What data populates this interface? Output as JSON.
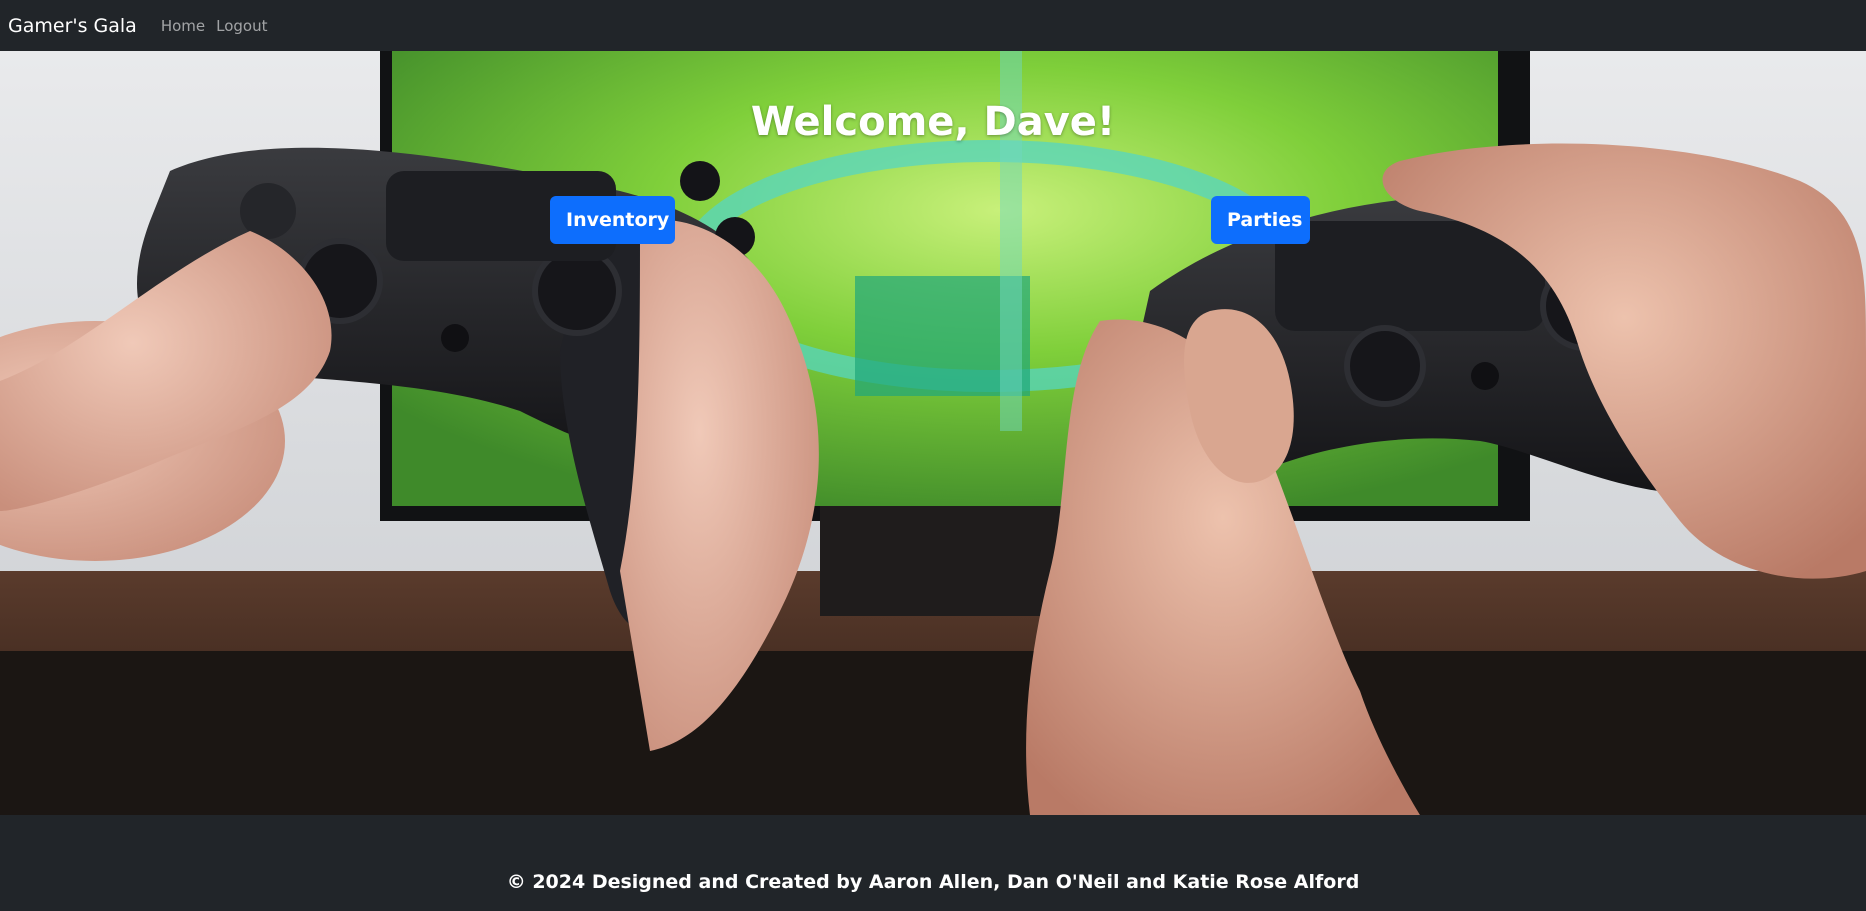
{
  "navbar": {
    "brand": "Gamer's Gala",
    "links": [
      {
        "label": "Home"
      },
      {
        "label": "Logout"
      }
    ]
  },
  "hero": {
    "title": "Welcome, Dave!",
    "buttons": {
      "inventory": "Inventory",
      "parties": "Parties"
    },
    "image_subject": "two pairs of hands holding game controllers in front of a TV"
  },
  "footer": {
    "text": "© 2024 Designed and Created by Aaron Allen, Dan O'Neil and Katie Rose Alford"
  },
  "colors": {
    "navbar_bg": "#212529",
    "button_primary": "#0d6efd",
    "text_light": "#ffffff"
  }
}
